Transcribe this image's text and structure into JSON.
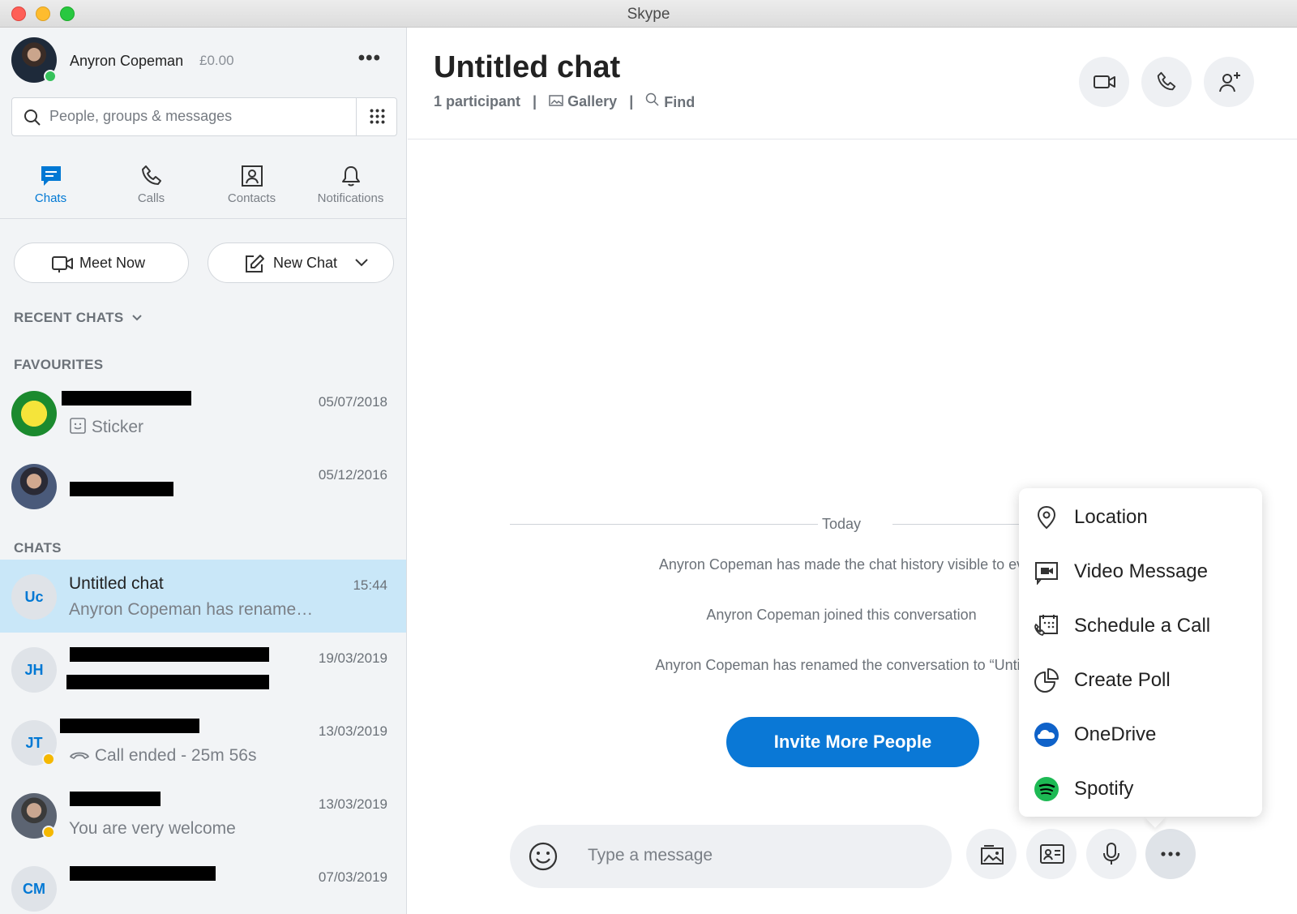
{
  "window": {
    "title": "Skype"
  },
  "profile": {
    "name": "Anyron Copeman",
    "credit": "£0.00"
  },
  "search": {
    "placeholder": "People, groups & messages"
  },
  "nav": {
    "chats": "Chats",
    "calls": "Calls",
    "contacts": "Contacts",
    "notifications": "Notifications"
  },
  "actions": {
    "meet_now": "Meet Now",
    "new_chat": "New Chat"
  },
  "sections": {
    "recent": "RECENT CHATS",
    "favourites": "FAVOURITES",
    "chats": "CHATS"
  },
  "favourites": [
    {
      "date": "05/07/2018",
      "preview": "Sticker"
    },
    {
      "date": "05/12/2016"
    }
  ],
  "chats": [
    {
      "initials": "Uc",
      "name": "Untitled chat",
      "time": "15:44",
      "preview": "Anyron Copeman has rename…",
      "selected": true
    },
    {
      "initials": "JH",
      "time": "19/03/2019"
    },
    {
      "initials": "JT",
      "time": "13/03/2019",
      "preview": "Call ended - 25m 56s"
    },
    {
      "time": "13/03/2019",
      "preview": "You are very welcome"
    },
    {
      "initials": "CM",
      "time": "07/03/2019"
    }
  ],
  "conversation": {
    "title": "Untitled chat",
    "participants": "1 participant",
    "gallery": "Gallery",
    "find": "Find",
    "separator": "|",
    "day_label": "Today",
    "system_messages": [
      "Anyron Copeman has made the chat history visible to ev",
      "Anyron Copeman joined this conversation",
      "Anyron Copeman has renamed the conversation to “Untitl"
    ],
    "invite_label": "Invite More People"
  },
  "composer": {
    "placeholder": "Type a message"
  },
  "more_menu": [
    {
      "label": "Location",
      "icon": "location-pin-icon"
    },
    {
      "label": "Video Message",
      "icon": "video-message-icon"
    },
    {
      "label": "Schedule a Call",
      "icon": "schedule-call-icon"
    },
    {
      "label": "Create Poll",
      "icon": "poll-icon"
    },
    {
      "label": "OneDrive",
      "icon": "onedrive-icon"
    },
    {
      "label": "Spotify",
      "icon": "spotify-icon"
    }
  ],
  "colors": {
    "accent": "#0078d4",
    "selected_row": "#c9e7f8",
    "sidebar_bg": "#f2f4f6",
    "online": "#36c25b",
    "away": "#f5b800"
  }
}
